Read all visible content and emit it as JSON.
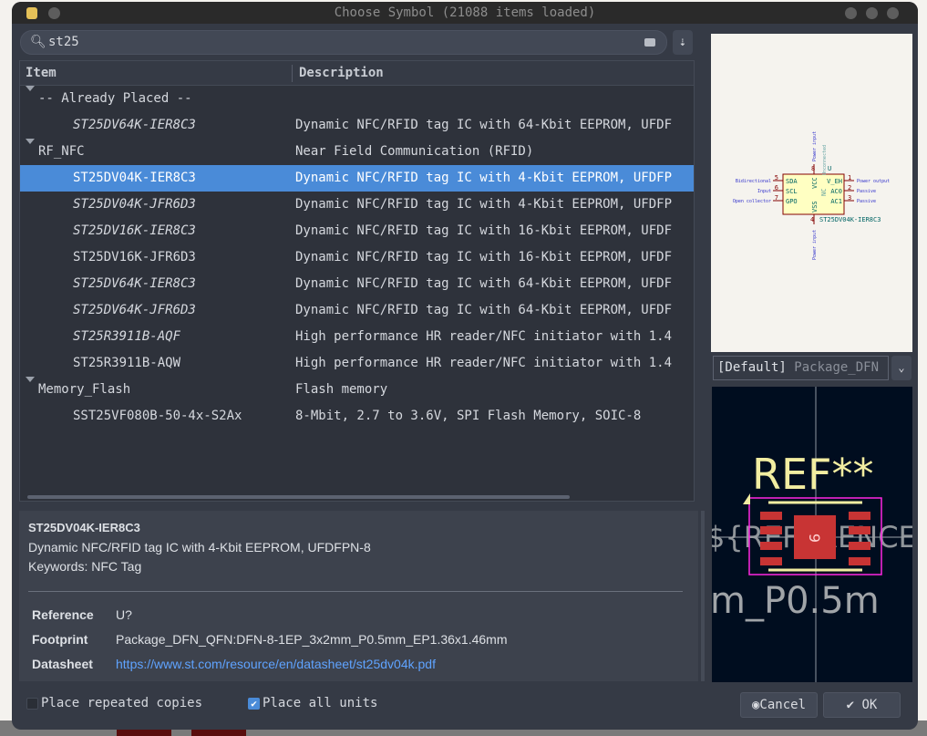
{
  "window": {
    "title": "Choose Symbol (21088 items loaded)"
  },
  "search": {
    "value": "st25",
    "icon": "search-icon",
    "clear_icon": "clear-icon"
  },
  "sort_icon": "sort-icon",
  "list": {
    "columns": [
      "Item",
      "Description"
    ],
    "rows": [
      {
        "item": "-- Already Placed --",
        "desc": "",
        "group": true,
        "italic": false
      },
      {
        "item": "ST25DV64K-IER8C3",
        "desc": "Dynamic NFC/RFID tag IC with 64-Kbit EEPROM, UFDF",
        "italic": true
      },
      {
        "item": "RF_NFC",
        "desc": "Near Field Communication (RFID)",
        "group": true,
        "italic": false
      },
      {
        "item": "ST25DV04K-IER8C3",
        "desc": "Dynamic NFC/RFID tag IC with 4-Kbit EEPROM, UFDFP",
        "italic": false,
        "selected": true
      },
      {
        "item": "ST25DV04K-JFR6D3",
        "desc": "Dynamic NFC/RFID tag IC with 4-Kbit EEPROM, UFDFP",
        "italic": true
      },
      {
        "item": "ST25DV16K-IER8C3",
        "desc": "Dynamic NFC/RFID tag IC with 16-Kbit EEPROM, UFDF",
        "italic": true
      },
      {
        "item": "ST25DV16K-JFR6D3",
        "desc": "Dynamic NFC/RFID tag IC with 16-Kbit EEPROM, UFDF",
        "italic": false
      },
      {
        "item": "ST25DV64K-IER8C3",
        "desc": "Dynamic NFC/RFID tag IC with 64-Kbit EEPROM, UFDF",
        "italic": true
      },
      {
        "item": "ST25DV64K-JFR6D3",
        "desc": "Dynamic NFC/RFID tag IC with 64-Kbit EEPROM, UFDF",
        "italic": true
      },
      {
        "item": "ST25R3911B-AQF",
        "desc": "High performance HR reader/NFC initiator with 1.4",
        "italic": true
      },
      {
        "item": "ST25R3911B-AQW",
        "desc": "High performance HR reader/NFC initiator with 1.4",
        "italic": false
      },
      {
        "item": "Memory_Flash",
        "desc": "Flash memory",
        "group": true,
        "italic": false
      },
      {
        "item": "SST25VF080B-50-4x-S2Ax",
        "desc": "8-Mbit, 2.7 to 3.6V, SPI Flash Memory, SOIC-8",
        "italic": false
      }
    ]
  },
  "details": {
    "name": "ST25DV04K-IER8C3",
    "description": "Dynamic NFC/RFID tag IC with 4-Kbit EEPROM, UFDFPN-8",
    "keywords": "Keywords: NFC Tag",
    "fields": [
      {
        "key": "Reference",
        "value": "U?"
      },
      {
        "key": "Footprint",
        "value": "Package_DFN_QFN:DFN-8-1EP_3x2mm_P0.5mm_EP1.36x1.46mm"
      },
      {
        "key": "Datasheet",
        "value": "https://www.st.com/resource/en/datasheet/st25dv04k.pdf",
        "link": true
      }
    ]
  },
  "options": {
    "repeat": {
      "label": "Place repeated copies",
      "checked": false
    },
    "all_units": {
      "label": "Place all units",
      "checked": true
    }
  },
  "buttons": {
    "cancel": "Cancel",
    "ok": "OK"
  },
  "symbol": {
    "ref": "U",
    "value": "ST25DV04K-IER8C3",
    "left_pins": [
      {
        "num": "5",
        "name": "SDA",
        "type": "Bidirectional"
      },
      {
        "num": "6",
        "name": "SCL",
        "type": "Input"
      },
      {
        "num": "7",
        "name": "GPO",
        "type": "Open collector"
      }
    ],
    "right_pins": [
      {
        "num": "1",
        "name": "V_EH",
        "type": "Power output"
      },
      {
        "num": "2",
        "name": "AC0",
        "type": "Passive"
      },
      {
        "num": "3",
        "name": "AC1",
        "type": "Passive"
      }
    ],
    "top_pins": [
      {
        "num": "8",
        "name": "VCC",
        "type": "Power input"
      },
      {
        "num": "9",
        "name": "NC",
        "type": "Unconnected"
      }
    ],
    "bottom_pins": [
      {
        "num": "4",
        "name": "VSS",
        "type": "Power input"
      }
    ]
  },
  "footprint": {
    "selector_default": "[Default]",
    "selector_value": "Package_DFN",
    "ref_text": "REF**",
    "ref_field": "${REFERENCE}",
    "value_fragment": "m_P0.5m",
    "pad_number": "9"
  },
  "colors": {
    "selection": "#4a8bd8",
    "pin": "#840000",
    "pin_type": "#3333cc",
    "body_fill": "#ffffc2",
    "fp_pad": "#c83434",
    "fp_courtyard": "#ff26e2",
    "fp_silk": "#f2eda1"
  }
}
